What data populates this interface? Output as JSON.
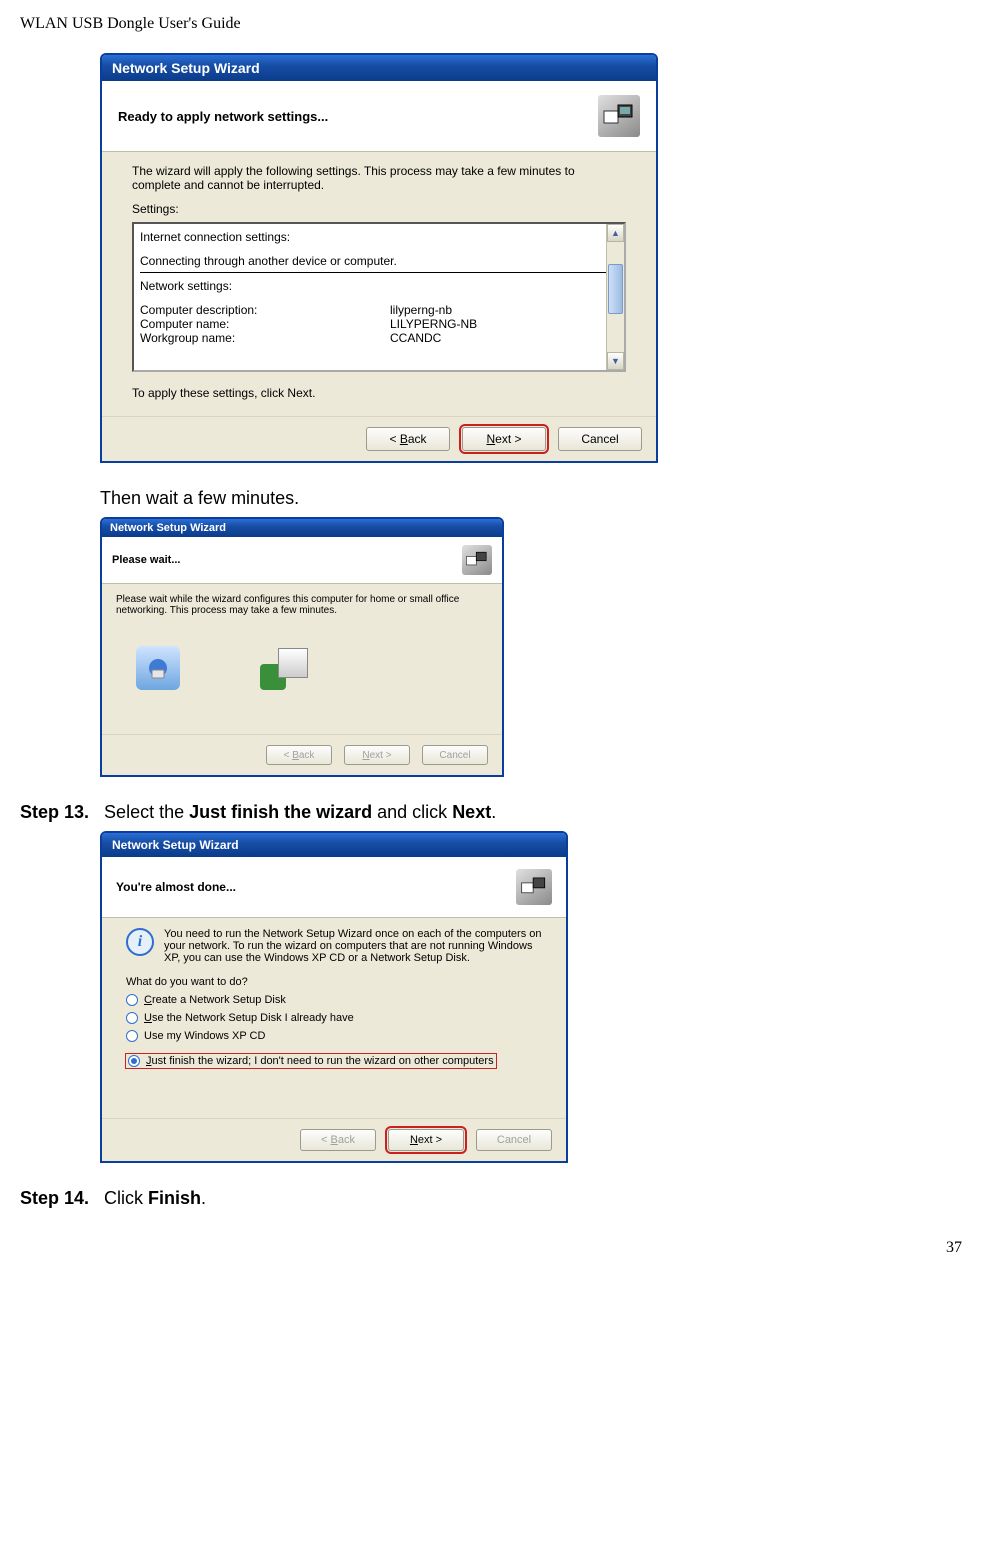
{
  "docHeader": "WLAN USB Dongle User's Guide",
  "pageNumber": "37",
  "wiz1": {
    "title": "Network Setup Wizard",
    "bannerTitle": "Ready to apply network settings...",
    "intro": "The wizard will apply the following settings. This process may take a few minutes to complete and cannot be interrupted.",
    "settingsLabel": "Settings:",
    "sec1": "Internet connection settings:",
    "sec1body": "Connecting through another device or computer.",
    "sec2": "Network settings:",
    "row1l": "Computer description:",
    "row1v": "lilyperng-nb",
    "row2l": "Computer name:",
    "row2v": "LILYPERNG-NB",
    "row3l": "Workgroup name:",
    "row3v": "CCANDC",
    "applyText": "To apply these settings, click Next.",
    "btnBackPrefix": "< ",
    "btnBackU": "B",
    "btnBackRest": "ack",
    "btnNextU": "N",
    "btnNextRest": "ext >",
    "btnCancel": "Cancel"
  },
  "bodyWait": "Then wait a few minutes.",
  "wiz2": {
    "title": "Network Setup Wizard",
    "bannerTitle": "Please wait...",
    "body": "Please wait while the wizard configures this computer for home or small office networking. This process may take a few minutes.",
    "btnBackPrefix": "< ",
    "btnBackU": "B",
    "btnBackRest": "ack",
    "btnNextU": "N",
    "btnNextRest": "ext >",
    "btnCancel": "Cancel"
  },
  "step13": {
    "label": "Step 13.",
    "pre": "Select the ",
    "bold": "Just finish the wizard",
    "mid": " and click ",
    "bold2": "Next",
    "post": "."
  },
  "wiz3": {
    "title": "Network Setup Wizard",
    "bannerTitle": "You're almost done...",
    "info": "You need to run the Network Setup Wizard once on each of the computers on your network. To run the wizard on computers that are not running Windows XP, you can use the Windows XP CD or a Network Setup Disk.",
    "q": "What do you want to do?",
    "opt1U": "C",
    "opt1Rest": "reate a Network Setup Disk",
    "opt2U": "U",
    "opt2Rest": "se the Network Setup Disk I already have",
    "opt3": "Use my Windows XP CD",
    "opt4U": "J",
    "opt4Rest": "ust finish the wizard; I don't need to run the wizard on other computers",
    "btnBackPrefix": "< ",
    "btnBackU": "B",
    "btnBackRest": "ack",
    "btnNextU": "N",
    "btnNextRest": "ext >",
    "btnCancel": "Cancel"
  },
  "step14": {
    "label": "Step 14.",
    "pre": "Click ",
    "bold": "Finish",
    "post": "."
  }
}
